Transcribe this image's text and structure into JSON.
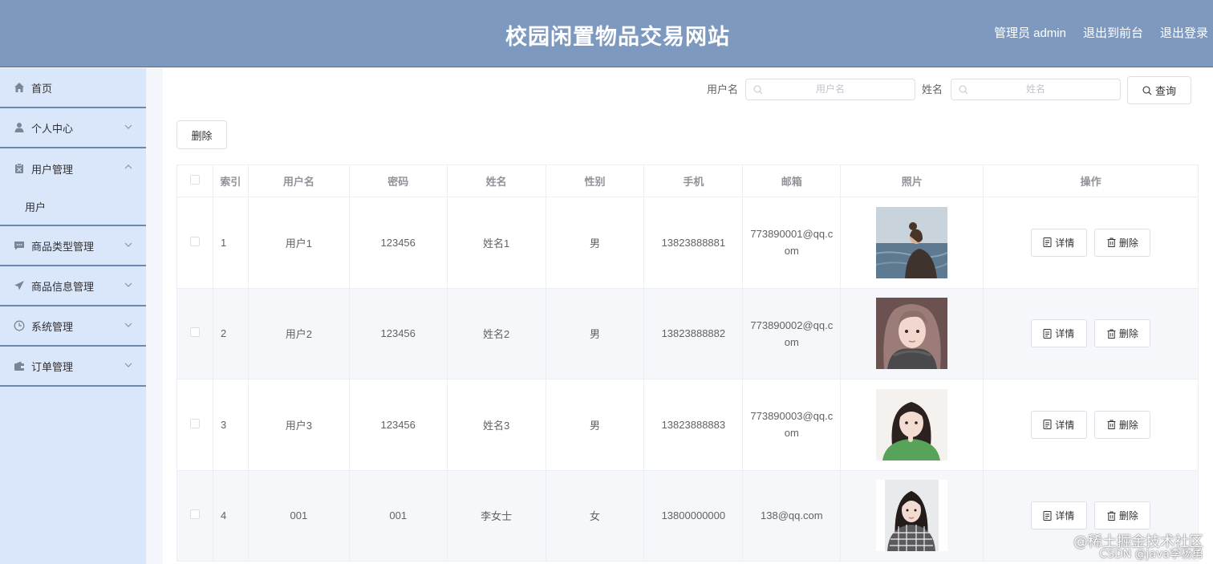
{
  "header": {
    "title": "校园闲置物品交易网站",
    "admin_label": "管理员 admin",
    "exit_front": "退出到前台",
    "logout": "退出登录"
  },
  "sidebar": {
    "items": [
      {
        "label": "首页",
        "icon": "home-icon",
        "chevron": ""
      },
      {
        "label": "个人中心",
        "icon": "user-icon",
        "chevron": "down"
      },
      {
        "label": "用户管理",
        "icon": "clipboard-icon",
        "chevron": "up",
        "submenu": [
          "用户"
        ]
      },
      {
        "label": "商品类型管理",
        "icon": "message-icon",
        "chevron": "down"
      },
      {
        "label": "商品信息管理",
        "icon": "send-icon",
        "chevron": "down"
      },
      {
        "label": "系统管理",
        "icon": "clock-icon",
        "chevron": "down"
      },
      {
        "label": "订单管理",
        "icon": "wallet-icon",
        "chevron": "down"
      }
    ]
  },
  "search": {
    "username_label": "用户名",
    "username_placeholder": "用户名",
    "name_label": "姓名",
    "name_placeholder": "姓名",
    "query_button": "查询"
  },
  "toolbar": {
    "delete_label": "删除"
  },
  "table": {
    "headers": [
      "索引",
      "用户名",
      "密码",
      "姓名",
      "性别",
      "手机",
      "邮箱",
      "照片",
      "操作"
    ],
    "rows": [
      {
        "index": "1",
        "username": "用户1",
        "password": "123456",
        "name": "姓名1",
        "gender": "男",
        "phone": "13823888881",
        "email": "773890001@qq.com",
        "photo": "photo-seaside-woman"
      },
      {
        "index": "2",
        "username": "用户2",
        "password": "123456",
        "name": "姓名2",
        "gender": "男",
        "phone": "13823888882",
        "email": "773890002@qq.com",
        "photo": "photo-scarf-woman"
      },
      {
        "index": "3",
        "username": "用户3",
        "password": "123456",
        "name": "姓名3",
        "gender": "男",
        "phone": "13823888883",
        "email": "773890003@qq.com",
        "photo": "photo-green-sweater-woman"
      },
      {
        "index": "4",
        "username": "001",
        "password": "001",
        "name": "李女士",
        "gender": "女",
        "phone": "13800000000",
        "email": "138@qq.com",
        "photo": "photo-plaid-woman"
      }
    ],
    "detail_button": "详情",
    "delete_button": "删除"
  },
  "watermark": {
    "line1": "@稀土掘金技术社区",
    "line2": "CSDN @java李杨勇"
  },
  "colors": {
    "header_bg": "#7d99bf",
    "sidebar_bg": "#dae7fb",
    "stripe_bg": "#f5f7fa"
  }
}
